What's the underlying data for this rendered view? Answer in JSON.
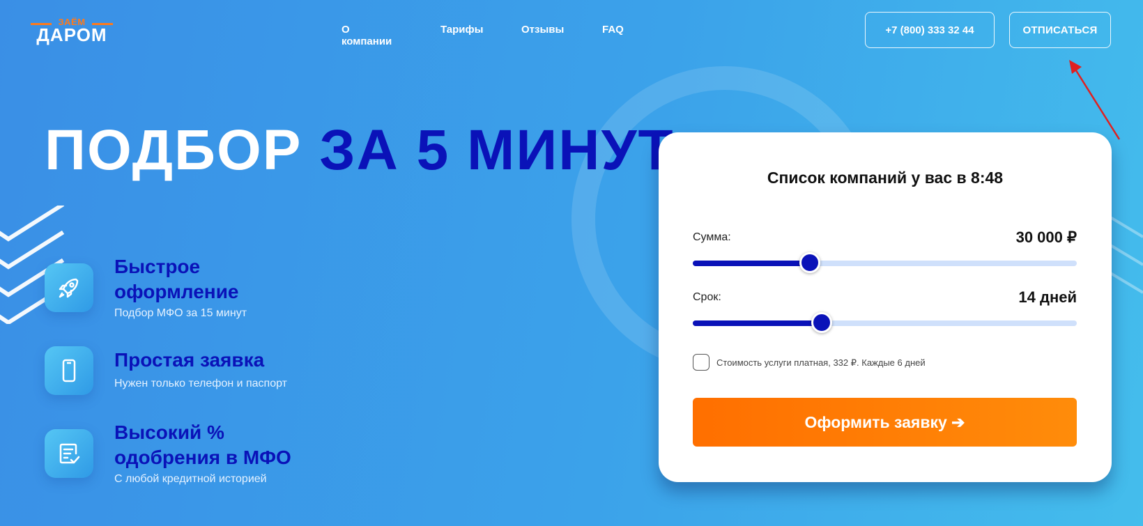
{
  "logo": {
    "top_text": "ЗАЁМ",
    "main_text": "ДАРОМ"
  },
  "nav": {
    "items": [
      "О компании",
      "Тарифы",
      "Отзывы",
      "FAQ"
    ]
  },
  "header": {
    "phone": "+7 (800) 333 32 44",
    "unsubscribe": "ОТПИСАТЬСЯ"
  },
  "hero": {
    "title_white": "ПОДБОР",
    "title_blue": "ЗА 5 МИНУТ"
  },
  "features": [
    {
      "title_line1": "Быстрое",
      "title_line2": "оформление",
      "subtitle": "Подбор МФО за 15 минут",
      "icon": "rocket-icon"
    },
    {
      "title_line1": "Простая заявка",
      "title_line2": "",
      "subtitle": "Нужен только телефон и паспорт",
      "icon": "phone-device-icon"
    },
    {
      "title_line1": "Высокий %",
      "title_line2": "одобрения в МФО",
      "subtitle": "С любой кредитной историей",
      "icon": "document-check-icon"
    }
  ],
  "card": {
    "title": "Список компаний у вас в 8:48",
    "amount": {
      "label": "Сумма:",
      "value": "30 000 ₽",
      "slider_fraction": 0.305
    },
    "term": {
      "label": "Срок:",
      "value": "14 дней",
      "slider_fraction": 0.335
    },
    "checkbox_label": "Стоимость услуги платная, 332 ₽. Каждые 6 дней",
    "checkbox_checked": false,
    "submit_label": "Оформить заявку ➔"
  },
  "colors": {
    "brand_blue": "#0a12b8",
    "accent_orange": "#ff7a1a",
    "annotation_red": "#e02020"
  }
}
